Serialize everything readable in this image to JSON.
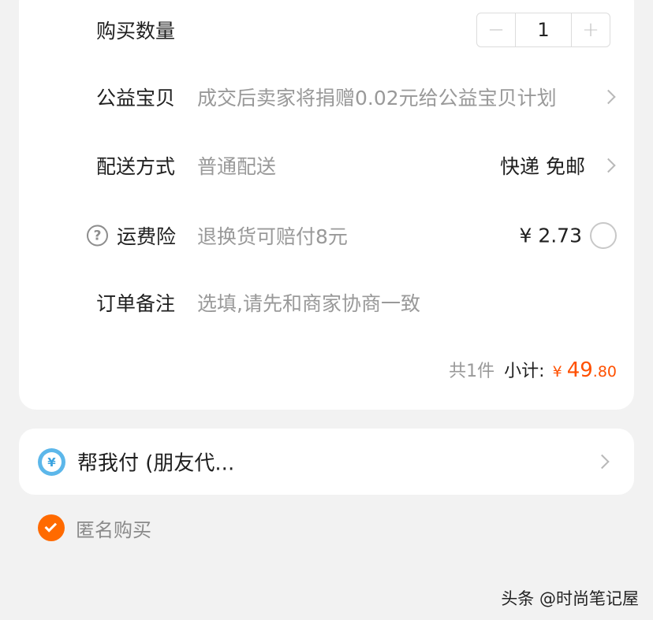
{
  "order": {
    "quantity": {
      "label": "购买数量",
      "value": "1",
      "minus": "−",
      "plus": "+"
    },
    "charity": {
      "label": "公益宝贝",
      "value": "成交后卖家将捐赠0.02元给公益宝贝计划"
    },
    "delivery": {
      "label": "配送方式",
      "value": "普通配送",
      "option": "快递 免邮"
    },
    "shipping_insurance": {
      "help": "?",
      "label": "运费险",
      "value": "退换货可赔付8元",
      "price": "¥ 2.73",
      "selected": false
    },
    "note": {
      "label": "订单备注",
      "placeholder": "选填,请先和商家协商一致"
    },
    "subtotal": {
      "count": "共1件",
      "label": "小计:",
      "currency": "¥",
      "integer": "49",
      "decimal": ".80"
    }
  },
  "pay_for_me": {
    "icon": "yen-coin-icon",
    "icon_glyph": "¥",
    "label": "帮我付 (朋友代..."
  },
  "anonymous": {
    "label": "匿名购买",
    "checked": true
  },
  "watermark": "头条 @时尚笔记屋",
  "colors": {
    "accent": "#ff5000",
    "check": "#ff6a00",
    "pay_icon": "#5cb7ea"
  }
}
